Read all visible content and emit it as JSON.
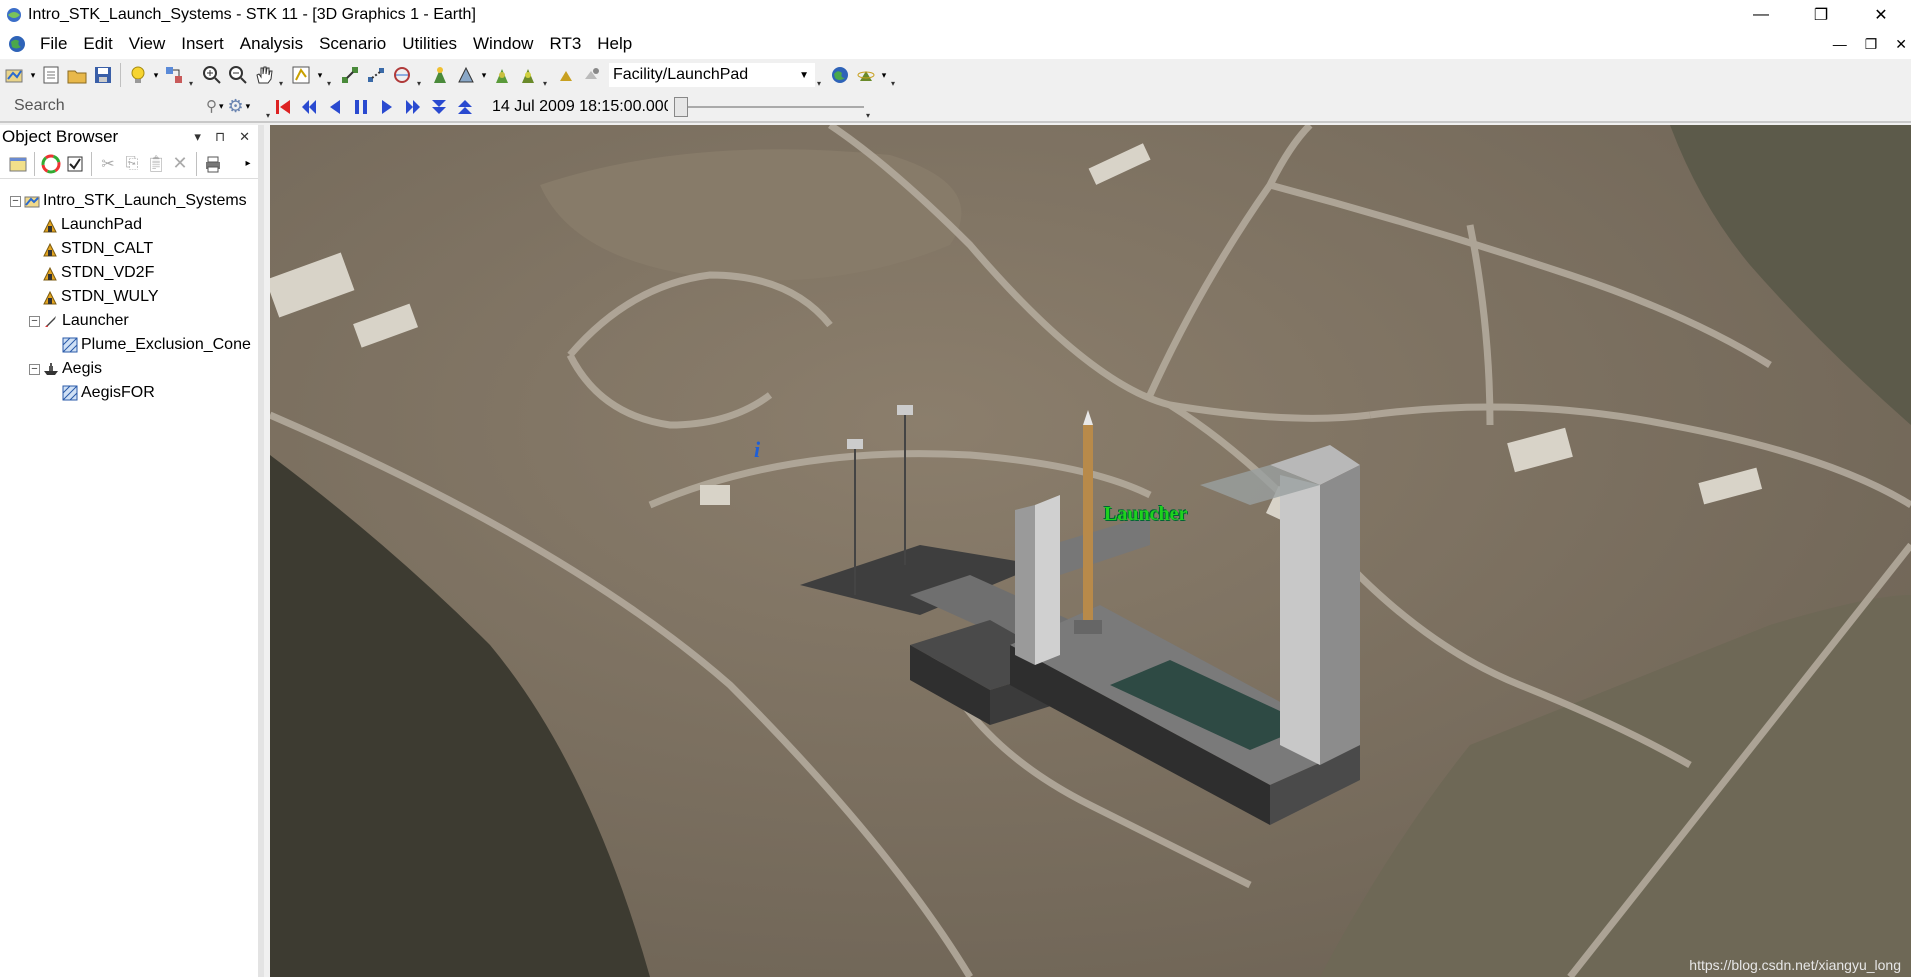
{
  "window": {
    "title": "Intro_STK_Launch_Systems - STK 11 - [3D Graphics 1 - Earth]",
    "controls": {
      "minimize": "—",
      "maximize": "❐",
      "close": "✕"
    },
    "mdi_controls": {
      "minimize": "—",
      "restore": "❐",
      "close": "✕"
    }
  },
  "menubar": {
    "items": [
      {
        "label": "File"
      },
      {
        "label": "Edit"
      },
      {
        "label": "View"
      },
      {
        "label": "Insert"
      },
      {
        "label": "Analysis"
      },
      {
        "label": "Scenario"
      },
      {
        "label": "Utilities"
      },
      {
        "label": "Window"
      },
      {
        "label": "RT3"
      },
      {
        "label": "Help"
      }
    ]
  },
  "toolbar": {
    "facility_select": "Facility/LaunchPad",
    "search_placeholder": "Search",
    "time": "14 Jul 2009 18:15:00.000",
    "time_slider_position": 0
  },
  "object_browser": {
    "title": "Object Browser",
    "header_controls": {
      "menu": "▾",
      "pin": "⊓",
      "close": "✕"
    },
    "tree": [
      {
        "label": "Intro_STK_Launch_Systems",
        "icon": "scenario-icon",
        "level": 0,
        "expander": "−"
      },
      {
        "label": "LaunchPad",
        "icon": "facility-icon",
        "level": 1
      },
      {
        "label": "STDN_CALT",
        "icon": "facility-icon",
        "level": 1
      },
      {
        "label": "STDN_VD2F",
        "icon": "facility-icon",
        "level": 1
      },
      {
        "label": "STDN_WULY",
        "icon": "facility-icon",
        "level": 1
      },
      {
        "label": "Launcher",
        "icon": "launch-vehicle-icon",
        "level": 1,
        "expander": "−"
      },
      {
        "label": "Plume_Exclusion_Cone",
        "icon": "sensor-icon",
        "level": 2
      },
      {
        "label": "Aegis",
        "icon": "ship-icon",
        "level": 1,
        "expander": "−"
      },
      {
        "label": "AegisFOR",
        "icon": "sensor-icon",
        "level": 2
      }
    ]
  },
  "viewport": {
    "object_label": "Launcher",
    "info_marker": "i",
    "watermark": "https://blog.csdn.net/xiangyu_long"
  },
  "colors": {
    "label_green": "#1ed21e",
    "ground": "#776c5e",
    "road": "#b3aa9c",
    "vegetation": "#3c3a2f"
  }
}
